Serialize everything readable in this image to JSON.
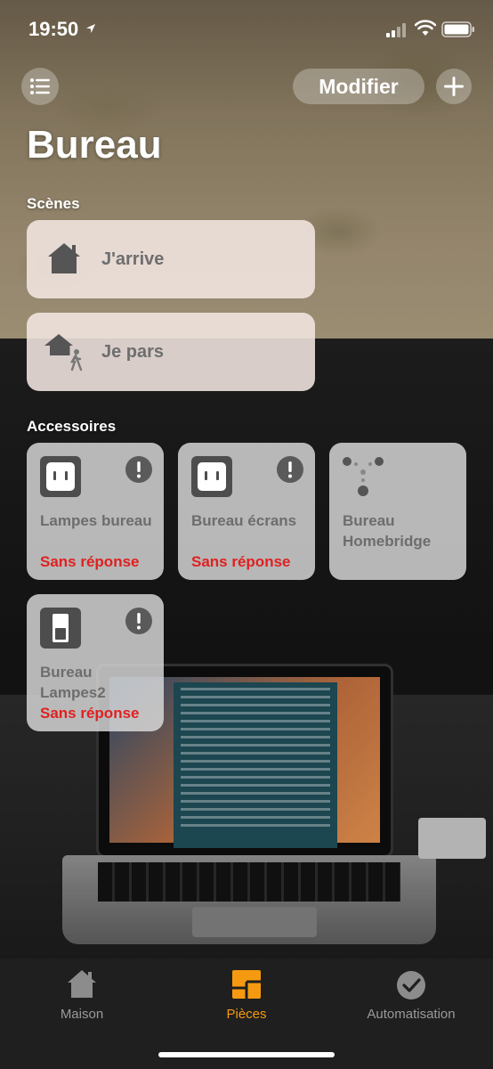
{
  "status_bar": {
    "time": "19:50",
    "icons": [
      "location-icon",
      "signal-icon",
      "wifi-icon",
      "battery-icon"
    ]
  },
  "nav": {
    "menu_icon": "list-icon",
    "edit_label": "Modifier",
    "add_icon": "plus-icon"
  },
  "page": {
    "title": "Bureau"
  },
  "scenes": {
    "label": "Scènes",
    "items": [
      {
        "label": "J'arrive",
        "icon": "house-icon"
      },
      {
        "label": "Je pars",
        "icon": "house-person-leaving-icon"
      }
    ]
  },
  "accessories": {
    "label": "Accessoires",
    "items": [
      {
        "name": "Lampes bureau",
        "status": "Sans réponse",
        "icon": "outlet-icon",
        "warning": true
      },
      {
        "name": "Bureau écrans",
        "status": "Sans réponse",
        "icon": "outlet-icon",
        "warning": true
      },
      {
        "name": "Bureau Homebridge",
        "status": "",
        "icon": "bridge-icon",
        "warning": false
      },
      {
        "name": "Bureau Lampes2",
        "status": "Sans réponse",
        "icon": "switch-icon",
        "warning": true
      }
    ]
  },
  "tab_bar": {
    "tabs": [
      {
        "label": "Maison",
        "icon": "house-icon",
        "active": false
      },
      {
        "label": "Pièces",
        "icon": "rooms-icon",
        "active": true
      },
      {
        "label": "Automatisation",
        "icon": "clock-check-icon",
        "active": false
      }
    ]
  },
  "colors": {
    "accent": "#f59a10",
    "error": "#e02020",
    "tile": "#dcdcdc",
    "scene_tile": "#f2e6e1"
  }
}
